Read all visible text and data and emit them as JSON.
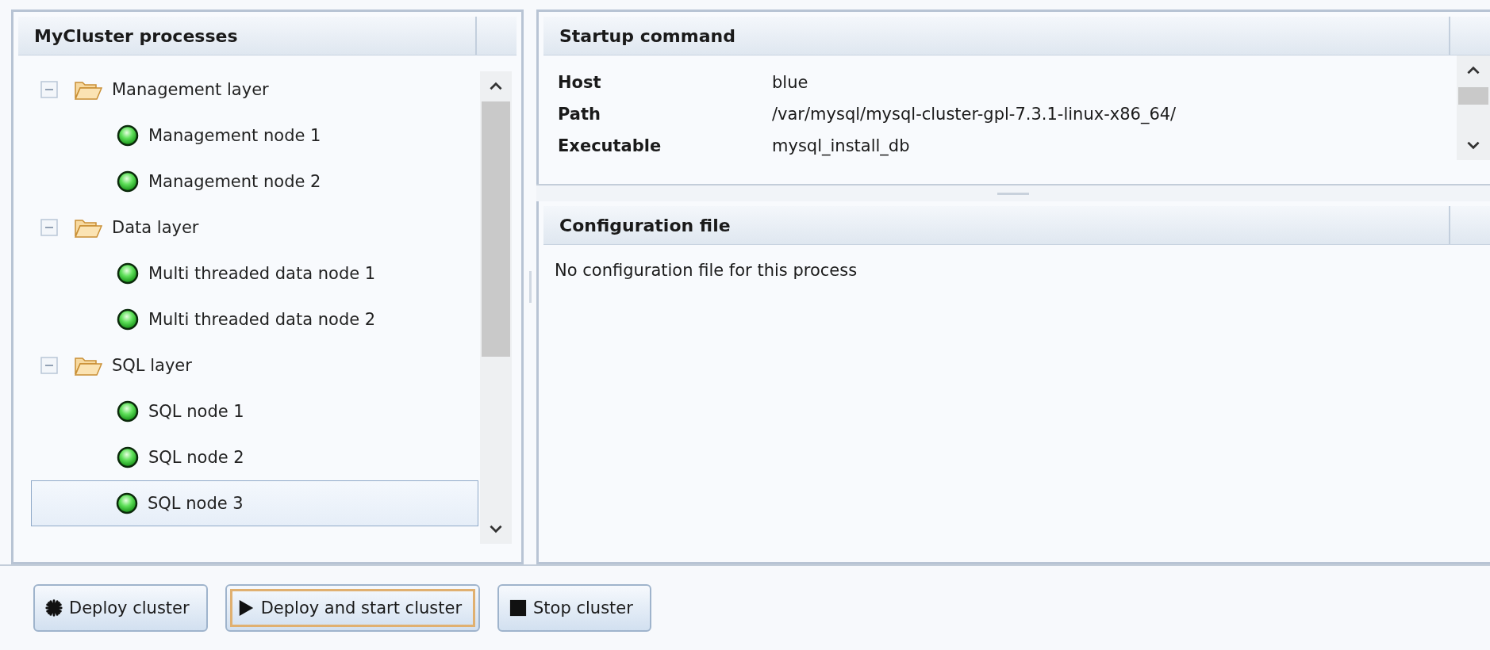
{
  "process_tree": {
    "title": "MyCluster processes",
    "items": [
      {
        "label": "Management layer",
        "kind": "folder",
        "expanded": true,
        "selected": false,
        "children": [
          {
            "label": "Management node 1",
            "kind": "process",
            "selected": false
          },
          {
            "label": "Management node 2",
            "kind": "process",
            "selected": false
          }
        ]
      },
      {
        "label": "Data layer",
        "kind": "folder",
        "expanded": true,
        "selected": false,
        "children": [
          {
            "label": "Multi threaded data node 1",
            "kind": "process",
            "selected": false
          },
          {
            "label": "Multi threaded data node 2",
            "kind": "process",
            "selected": false
          }
        ]
      },
      {
        "label": "SQL layer",
        "kind": "folder",
        "expanded": true,
        "selected": false,
        "children": [
          {
            "label": "SQL node 1",
            "kind": "process",
            "selected": false
          },
          {
            "label": "SQL node 2",
            "kind": "process",
            "selected": false
          },
          {
            "label": "SQL node 3",
            "kind": "process",
            "selected": true
          }
        ]
      }
    ]
  },
  "startup_command": {
    "title": "Startup command",
    "fields": [
      {
        "label": "Host",
        "value": "blue"
      },
      {
        "label": "Path",
        "value": "/var/mysql/mysql-cluster-gpl-7.3.1-linux-x86_64/"
      },
      {
        "label": "Executable",
        "value": "mysql_install_db"
      }
    ]
  },
  "configuration_file": {
    "title": "Configuration file",
    "message": "No configuration file for this process"
  },
  "buttons": [
    {
      "label": "Deploy cluster",
      "kind": "deploy",
      "focused": false
    },
    {
      "label": "Deploy and start cluster",
      "kind": "start",
      "focused": true
    },
    {
      "label": "Stop cluster",
      "kind": "stop",
      "focused": false
    }
  ]
}
